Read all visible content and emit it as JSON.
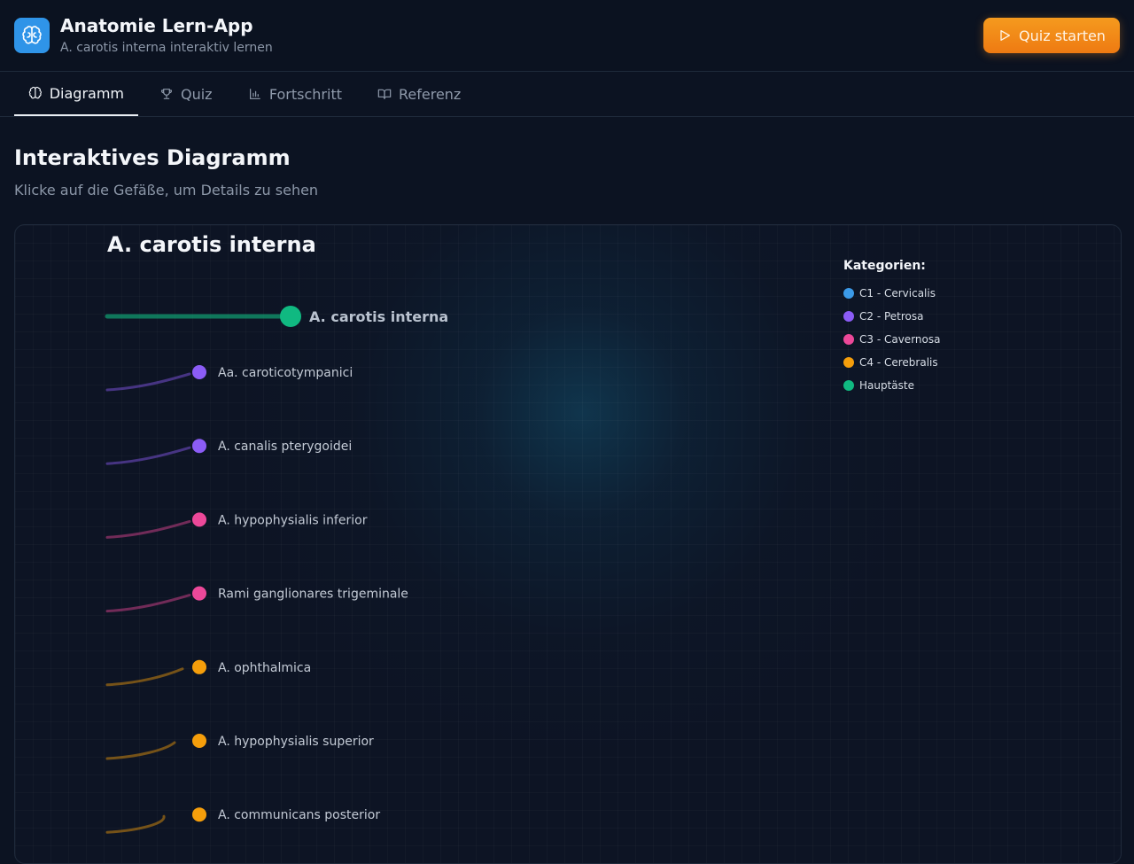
{
  "header": {
    "title": "Anatomie Lern-App",
    "subtitle": "A. carotis interna interaktiv lernen",
    "quiz_button": "Quiz starten"
  },
  "tabs": [
    {
      "label": "Diagramm",
      "icon": "brain-icon",
      "active": true
    },
    {
      "label": "Quiz",
      "icon": "trophy-icon",
      "active": false
    },
    {
      "label": "Fortschritt",
      "icon": "bar-chart-icon",
      "active": false
    },
    {
      "label": "Referenz",
      "icon": "book-icon",
      "active": false
    }
  ],
  "section": {
    "title": "Interaktives Diagramm",
    "subtitle": "Klicke auf die Gefäße, um Details zu sehen"
  },
  "diagram": {
    "title": "A. carotis interna",
    "root": {
      "label": "A. carotis interna",
      "color": "#10b981"
    },
    "branches": [
      {
        "label": "Aa. caroticotympanici",
        "color": "#8b5cf6"
      },
      {
        "label": "A. canalis pterygoidei",
        "color": "#8b5cf6"
      },
      {
        "label": "A. hypophysialis inferior",
        "color": "#ec4899"
      },
      {
        "label": "Rami ganglionares trigeminale",
        "color": "#ec4899"
      },
      {
        "label": "A. ophthalmica",
        "color": "#f59e0b"
      },
      {
        "label": "A. hypophysialis superior",
        "color": "#f59e0b"
      },
      {
        "label": "A. communicans posterior",
        "color": "#f59e0b"
      }
    ]
  },
  "legend": {
    "title": "Kategorien:",
    "items": [
      {
        "label": "C1 - Cervicalis",
        "color": "#3b9ae8"
      },
      {
        "label": "C2 - Petrosa",
        "color": "#8b5cf6"
      },
      {
        "label": "C3 - Cavernosa",
        "color": "#ec4899"
      },
      {
        "label": "C4 - Cerebralis",
        "color": "#f59e0b"
      },
      {
        "label": "Hauptäste",
        "color": "#10b981"
      }
    ]
  }
}
